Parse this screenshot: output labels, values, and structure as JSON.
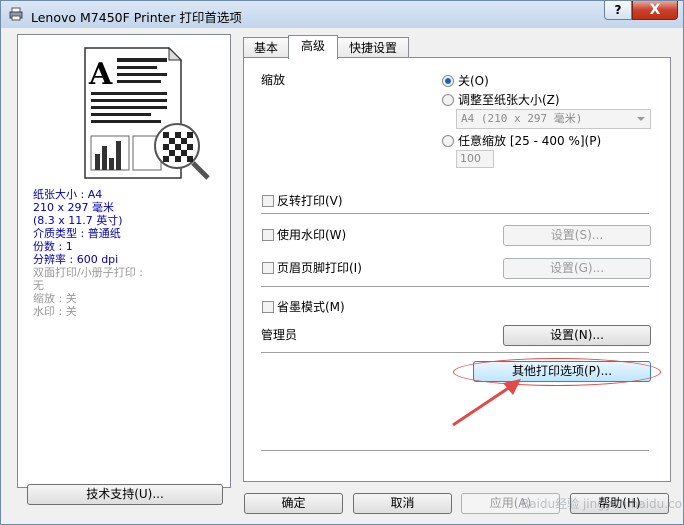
{
  "window": {
    "title": "Lenovo M7450F Printer 打印首选项",
    "help_glyph": "?",
    "close_glyph": "X"
  },
  "left": {
    "info": [
      {
        "text": "纸张大小 : A4",
        "color": "blue"
      },
      {
        "text": "210 x 297 毫米",
        "color": "blue"
      },
      {
        "text": "(8.3 x 11.7 英寸)",
        "color": "blue"
      },
      {
        "text": "介质类型 : 普通纸",
        "color": "blue"
      },
      {
        "text": "份数 : 1",
        "color": "blue"
      },
      {
        "text": "分辨率 : 600 dpi",
        "color": "blue"
      },
      {
        "text": "双面打印/小册子打印 :",
        "color": "gray"
      },
      {
        "text": "无",
        "color": "gray"
      },
      {
        "text": "缩放 : 关",
        "color": "gray"
      },
      {
        "text": "水印 : 关",
        "color": "gray"
      }
    ],
    "support_button": "技术支持(U)..."
  },
  "tabs": [
    "基本",
    "高级",
    "快捷设置"
  ],
  "active_tab": 1,
  "advanced": {
    "scale_label": "缩放",
    "scale_options": [
      "关(O)",
      "调整至纸张大小(Z)",
      "任意缩放 [25 - 400 %](P)"
    ],
    "scale_selected": 0,
    "paper_select": "A4 (210 x 297 毫米)",
    "percent_value": "100",
    "reverse_print": "反转打印(V)",
    "watermark": "使用水印(W)",
    "watermark_button": "设置(S)...",
    "header_footer": "页眉页脚打印(I)",
    "header_footer_button": "设置(G)...",
    "toner_save": "省墨模式(M)",
    "admin_label": "管理员",
    "admin_button": "设置(N)...",
    "other_options_button": "其他打印选项(P)..."
  },
  "footer": {
    "ok": "确定",
    "cancel": "取消",
    "apply": "应用(A)",
    "help": "帮助(H)"
  },
  "watermark_text": "Baidu经验 jingyan.baidu.com",
  "colors": {
    "annotation": "#e24a4a",
    "info_blue": "#0000b0"
  }
}
